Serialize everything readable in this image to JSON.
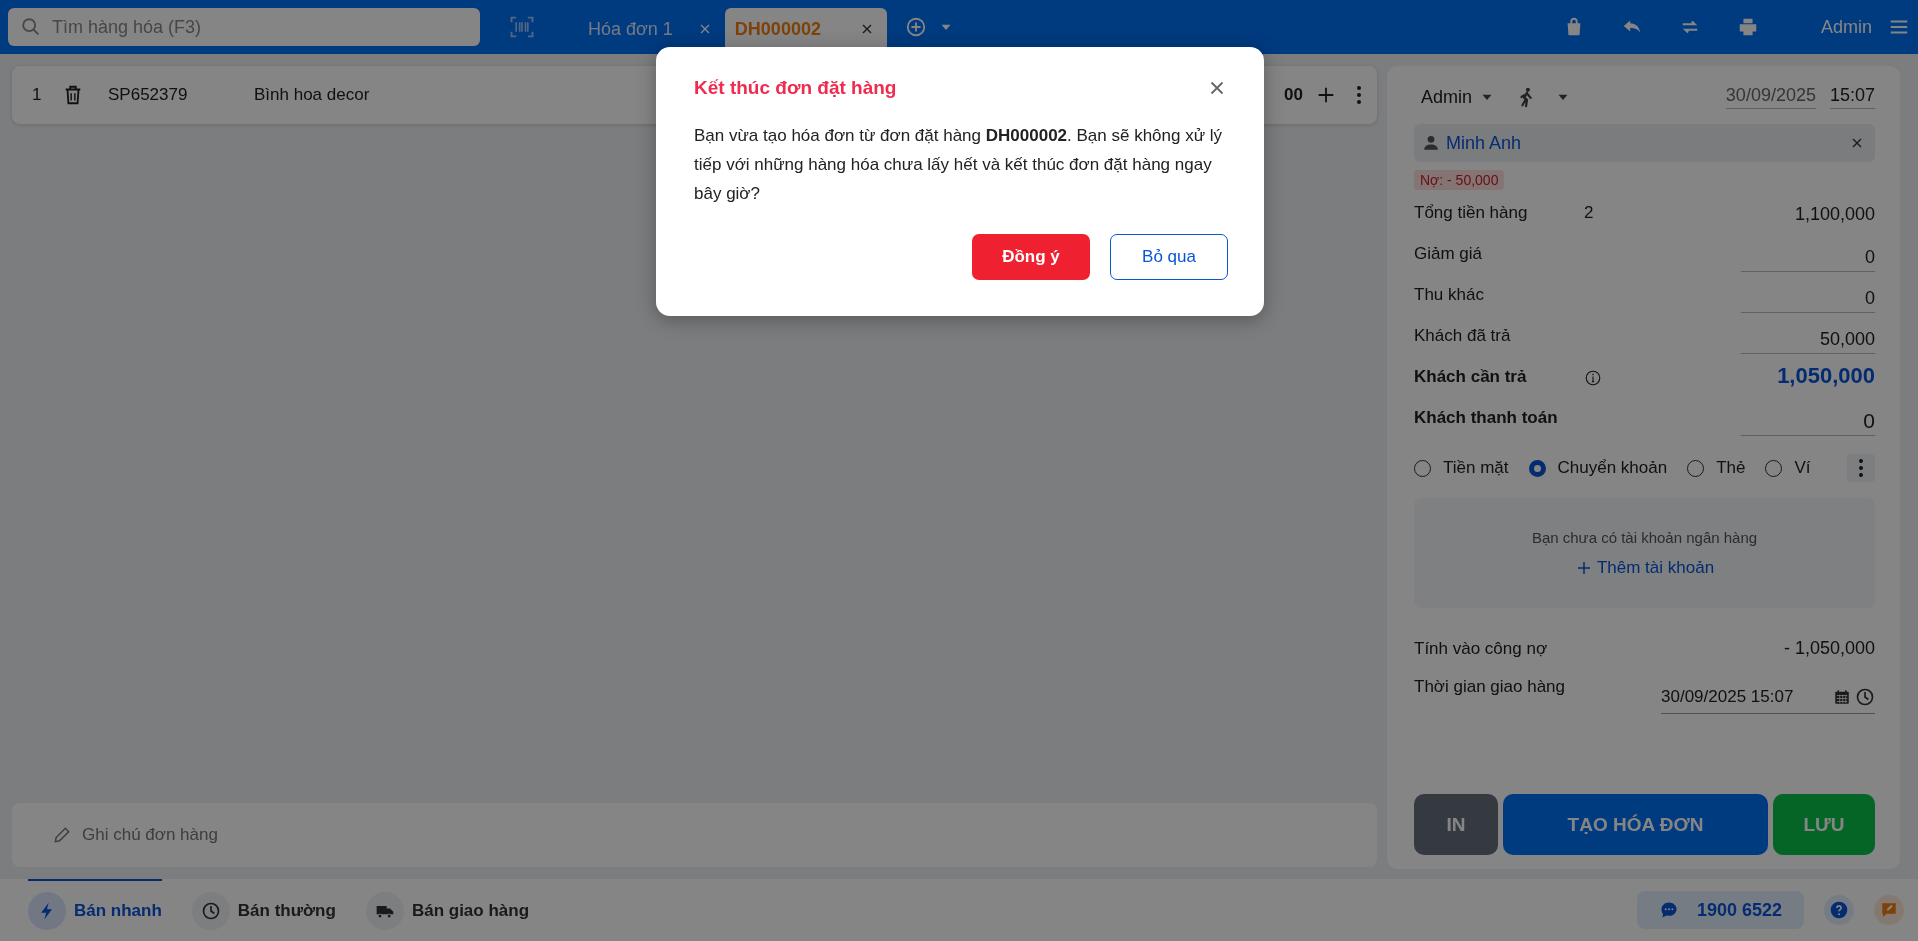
{
  "search": {
    "placeholder": "Tìm hàng hóa (F3)"
  },
  "tabs": [
    {
      "label": "Hóa đơn 1",
      "selected": false
    },
    {
      "label": "DH000002",
      "selected": true
    }
  ],
  "header": {
    "user": "Admin"
  },
  "order_lines": [
    {
      "index": "1",
      "code": "SP652379",
      "name": "Bình hoa decor",
      "amount": "00"
    }
  ],
  "note": {
    "placeholder": "Ghi chú đơn hàng"
  },
  "modes": [
    {
      "label": "Bán nhanh",
      "selected": true,
      "kind": "bolt"
    },
    {
      "label": "Bán thường",
      "selected": false,
      "kind": "clock"
    },
    {
      "label": "Bán giao hàng",
      "selected": false,
      "kind": "truck"
    }
  ],
  "hotline": "1900 6522",
  "panel": {
    "seller": "Admin",
    "date": "30/09/2025",
    "time": "15:07",
    "customer": "Minh Anh",
    "debt_badge": "Nợ: - 50,000",
    "summary": [
      {
        "label": "Tổng tiền hàng",
        "count": "2",
        "value": "1,100,000",
        "kind": "plain"
      },
      {
        "label": "Giảm giá",
        "value": "0",
        "kind": "field"
      },
      {
        "label": "Thu khác",
        "value": "0",
        "kind": "field"
      },
      {
        "label": "Khách đã trả",
        "value": "50,000",
        "kind": "field"
      },
      {
        "label": "Khách cần trả",
        "value": "1,050,000",
        "kind": "total"
      },
      {
        "label": "Khách thanh toán",
        "value": "0",
        "kind": "pay"
      }
    ],
    "payment_methods": [
      {
        "label": "Tiền mặt",
        "selected": false
      },
      {
        "label": "Chuyển khoản",
        "selected": true
      },
      {
        "label": "Thẻ",
        "selected": false
      },
      {
        "label": "Ví",
        "selected": false
      }
    ],
    "bank_notice": "Bạn chưa có tài khoản ngân hàng",
    "add_account": "Thêm tài khoản",
    "debt_label": "Tính vào công nợ",
    "debt_value": "- 1,050,000",
    "delivery_label": "Thời gian giao hàng",
    "delivery_time": "30/09/2025 15:07",
    "actions": [
      {
        "label": "IN",
        "kind": "print"
      },
      {
        "label": "TẠO HÓA ĐƠN",
        "kind": "primary"
      },
      {
        "label": "LƯU",
        "kind": "save"
      }
    ]
  },
  "dialog": {
    "title": "Kết thúc đơn đặt hàng",
    "message": "Bạn vừa tạo hóa đơn từ đơn đặt hàng **DH000002**. Bạn sẽ không xử lý tiếp với những hàng hóa chưa lấy hết và kết thúc đơn đặt hàng ngay bây giờ?",
    "buttons": [
      {
        "label": "Đồng ý",
        "kind": "confirm"
      },
      {
        "label": "Bỏ qua",
        "kind": "cancel"
      }
    ]
  }
}
